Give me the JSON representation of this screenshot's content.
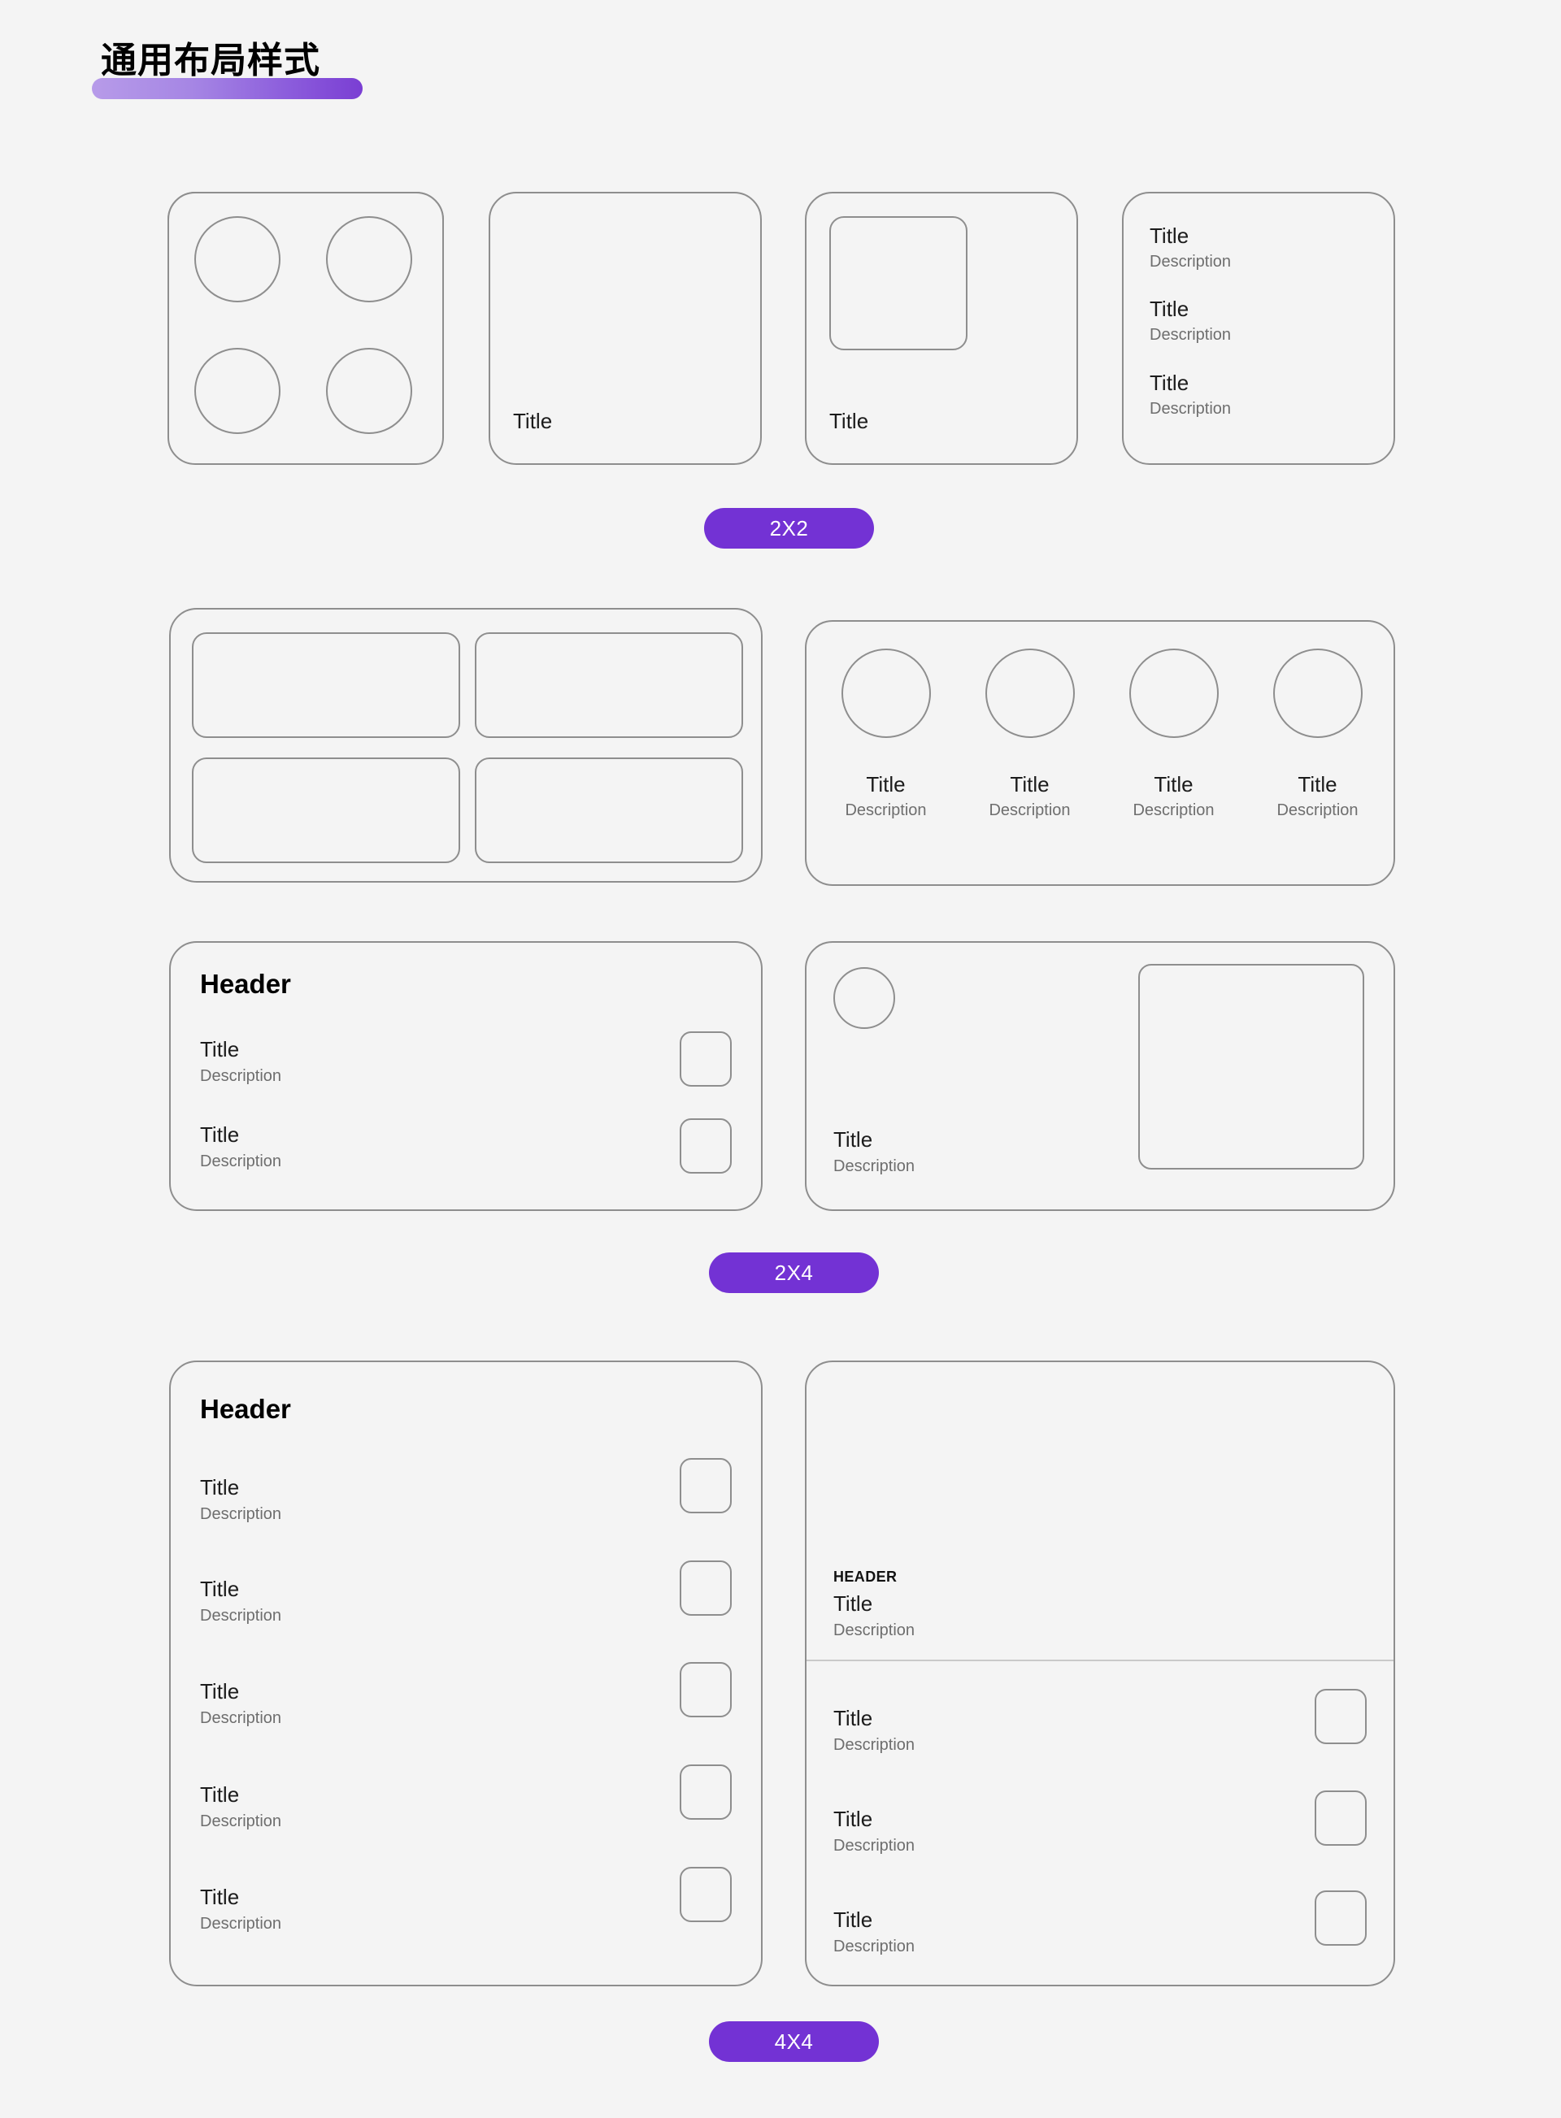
{
  "page": {
    "title": "通用布局样式",
    "background_color": "#f4f4f4",
    "accent_color": "#7332d4",
    "highlight_gradient_from": "#b79be9",
    "highlight_gradient_to": "#7a3ed3",
    "border_color": "#8e8e8e",
    "title_color": "#1c1c1c",
    "description_color": "#6e6e6e"
  },
  "labels": {
    "title": "Title",
    "description": "Description",
    "header": "Header",
    "header_caps": "HEADER"
  },
  "sections": [
    {
      "id": "section-2x2",
      "badge": "2X2",
      "cards": [
        {
          "id": "card-2x2-four-circles",
          "kind": "four-circles",
          "circles": 4
        },
        {
          "id": "card-2x2-empty-title",
          "kind": "empty-with-title",
          "title": "Title"
        },
        {
          "id": "card-2x2-icon-title",
          "kind": "icon-with-title",
          "title": "Title"
        },
        {
          "id": "card-2x2-list",
          "kind": "title-description-list",
          "rows": [
            {
              "title": "Title",
              "description": "Description"
            },
            {
              "title": "Title",
              "description": "Description"
            },
            {
              "title": "Title",
              "description": "Description"
            }
          ]
        }
      ]
    },
    {
      "id": "section-2x4",
      "badge": "2X4",
      "cards": [
        {
          "id": "card-2x4-grid",
          "kind": "two-by-two-boxes",
          "boxes": 4
        },
        {
          "id": "card-2x4-avatars",
          "kind": "avatar-row",
          "items": [
            {
              "title": "Title",
              "description": "Description"
            },
            {
              "title": "Title",
              "description": "Description"
            },
            {
              "title": "Title",
              "description": "Description"
            },
            {
              "title": "Title",
              "description": "Description"
            }
          ]
        },
        {
          "id": "card-2x4-header-rows",
          "kind": "header-with-rows",
          "header": "Header",
          "rows": [
            {
              "title": "Title",
              "description": "Description"
            },
            {
              "title": "Title",
              "description": "Description"
            }
          ]
        },
        {
          "id": "card-2x4-media",
          "kind": "avatar-media",
          "title": "Title",
          "description": "Description"
        }
      ]
    },
    {
      "id": "section-4x4",
      "badge": "4X4",
      "cards": [
        {
          "id": "card-4x4-header-rows",
          "kind": "header-with-rows",
          "header": "Header",
          "rows": [
            {
              "title": "Title",
              "description": "Description"
            },
            {
              "title": "Title",
              "description": "Description"
            },
            {
              "title": "Title",
              "description": "Description"
            },
            {
              "title": "Title",
              "description": "Description"
            },
            {
              "title": "Title",
              "description": "Description"
            }
          ]
        },
        {
          "id": "card-4x4-hero-rows",
          "kind": "hero-with-rows",
          "hero": {
            "header_caps": "HEADER",
            "title": "Title",
            "description": "Description"
          },
          "rows": [
            {
              "title": "Title",
              "description": "Description"
            },
            {
              "title": "Title",
              "description": "Description"
            },
            {
              "title": "Title",
              "description": "Description"
            }
          ]
        }
      ]
    }
  ]
}
